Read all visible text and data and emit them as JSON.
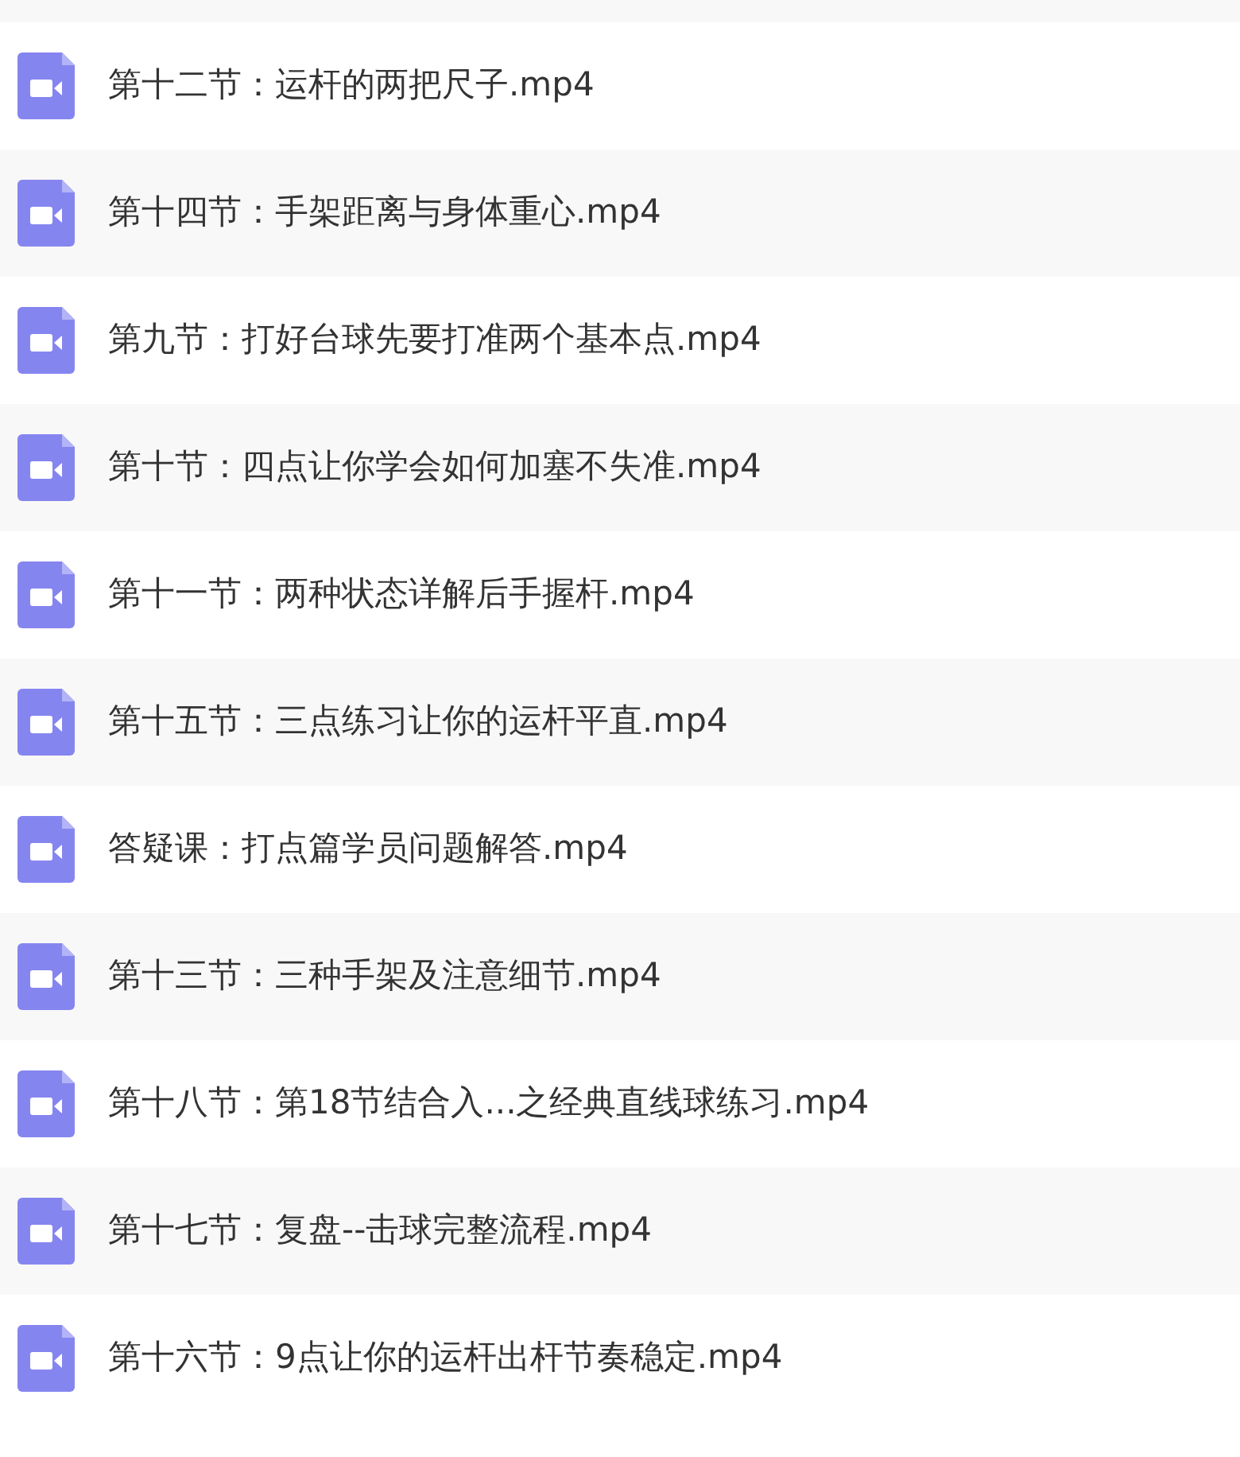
{
  "files": [
    {
      "name": "第十二节：运杆的两把尺子.mp4"
    },
    {
      "name": "第十四节：手架距离与身体重心.mp4"
    },
    {
      "name": "第九节：打好台球先要打准两个基本点.mp4"
    },
    {
      "name": "第十节：四点让你学会如何加塞不失准.mp4"
    },
    {
      "name": "第十一节：两种状态详解后手握杆.mp4"
    },
    {
      "name": "第十五节：三点练习让你的运杆平直.mp4"
    },
    {
      "name": "答疑课：打点篇学员问题解答.mp4"
    },
    {
      "name": "第十三节：三种手架及注意细节.mp4"
    },
    {
      "name": "第十八节：第18节结合入...之经典直线球练习.mp4"
    },
    {
      "name": "第十七节：复盘--击球完整流程.mp4"
    },
    {
      "name": "第十六节：9点让你的运杆出杆节奏稳定.mp4"
    }
  ]
}
